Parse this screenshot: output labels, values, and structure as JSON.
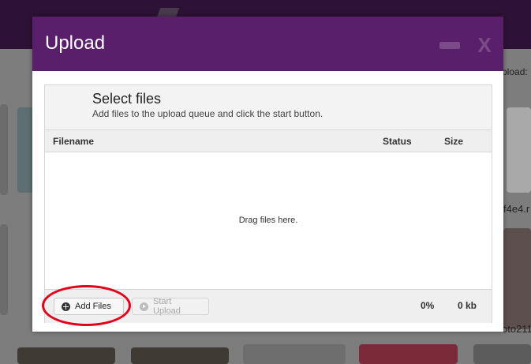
{
  "background": {
    "right_label_1": "pload:",
    "right_label_2": "f4e4.r",
    "right_label_3": "oto211"
  },
  "dialog": {
    "title": "Upload",
    "minimize_icon": "minus-icon",
    "close_label": "X"
  },
  "uploader": {
    "title": "Select files",
    "subtitle": "Add files to the upload queue and click the start button.",
    "columns": {
      "filename": "Filename",
      "status": "Status",
      "size": "Size"
    },
    "drop_text": "Drag files here.",
    "add_files_label": "Add Files",
    "start_upload_label": "Start Upload",
    "progress": "0%",
    "total_size": "0 kb"
  },
  "colors": {
    "header_purple": "#5a1f6a",
    "highlight_red": "#e3001b"
  }
}
